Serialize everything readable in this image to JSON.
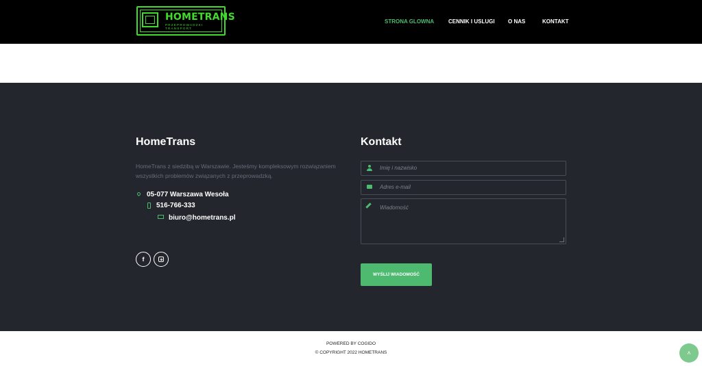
{
  "header": {
    "logo_name": "HOMETRANS",
    "logo_sub": "PRZEPROWADZKI TRANSPORT",
    "nav": [
      "STRONA GLOWNA",
      "CENNIK I USLUGI",
      "O NAS",
      "KONTAKT"
    ],
    "active_nav": "STRONA GLOWNA"
  },
  "about": {
    "title": "HomeTrans",
    "description": "HomeTrans z siedzibą w Warszawie. Jesteśmy kompleksowym rozwiązaniem wszystkich problemów związanych z przeprowadzką.",
    "address": "05-077 Warszawa Wesoła",
    "phone": "516-766-333",
    "email": "biuro@hometrans.pl",
    "social": [
      "facebook-icon",
      "instagram-icon"
    ],
    "facebook_glyph": "f"
  },
  "contact": {
    "title": "Kontakt",
    "name_placeholder": "Imię i nazwisko",
    "email_placeholder": "Adres e-mail",
    "message_placeholder": "Wiadomość",
    "submit_label": "WYŚLIJ WIADOMOŚĆ"
  },
  "footer": {
    "powered": "POWERED BY COGIDO",
    "copyright": "© COPYRIGHT 2022 HOMETRANS",
    "to_top_glyph": "˄"
  },
  "colors": {
    "accent": "#4eba6f",
    "logo_green": "#3fdc2a",
    "header_bg": "#000000",
    "band_bg": "#23262d"
  }
}
